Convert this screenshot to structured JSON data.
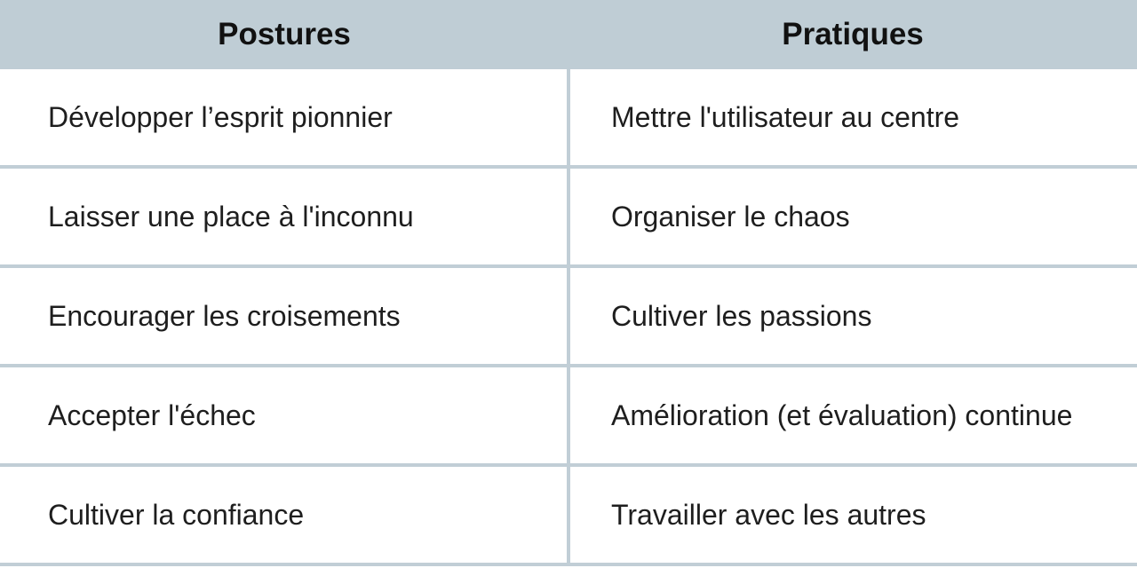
{
  "header": {
    "left": "Postures",
    "right": "Pratiques"
  },
  "rows": [
    {
      "posture": "Développer l’esprit pionnier",
      "pratique": "Mettre l'utilisateur au centre"
    },
    {
      "posture": "Laisser une place à l'inconnu",
      "pratique": "Organiser le chaos"
    },
    {
      "posture": "Encourager les croisements",
      "pratique": "Cultiver les passions"
    },
    {
      "posture": "Accepter l'échec",
      "pratique": "Amélioration (et évaluation) continue"
    },
    {
      "posture": "Cultiver la confiance",
      "pratique": "Travailler avec les autres"
    }
  ],
  "colors": {
    "header_bg": "#bfcdd5",
    "divider": "#c1ced6",
    "text": "#1e1e1e"
  }
}
